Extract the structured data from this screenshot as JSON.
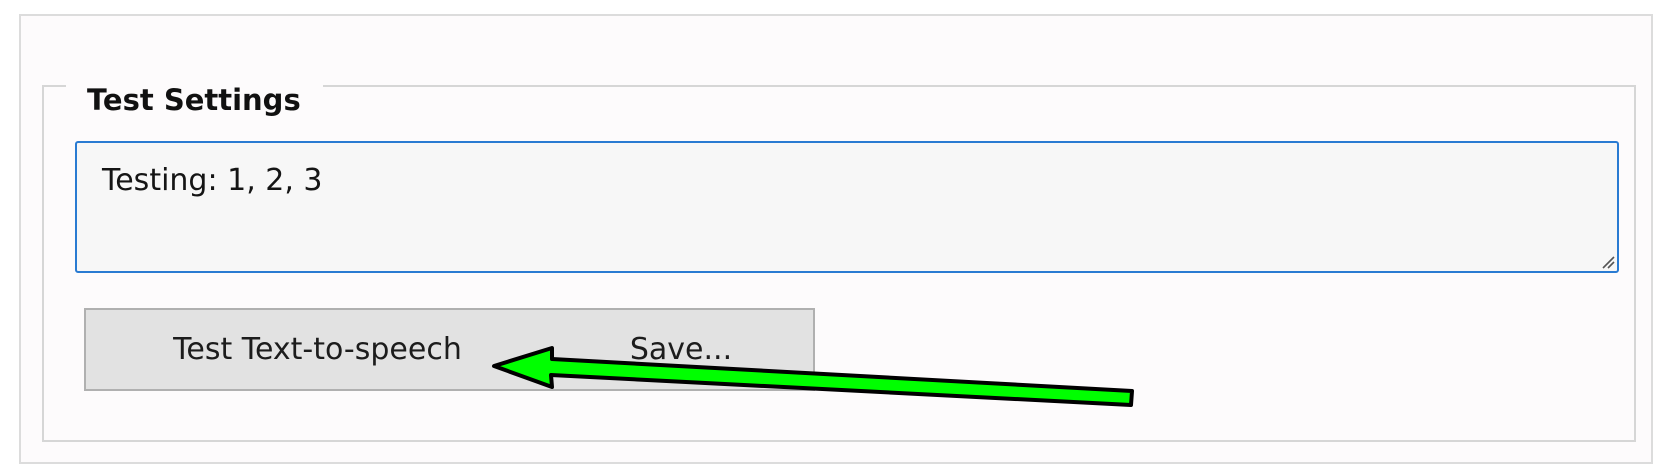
{
  "group": {
    "title": "Test Settings"
  },
  "textbox": {
    "value": "Testing: 1, 2, 3"
  },
  "buttons": {
    "test_label": "Test Text-to-speech",
    "save_label": "Save..."
  },
  "annotation": {
    "icon": "arrow-icon",
    "color": "#00ff00",
    "outline": "#000000"
  }
}
